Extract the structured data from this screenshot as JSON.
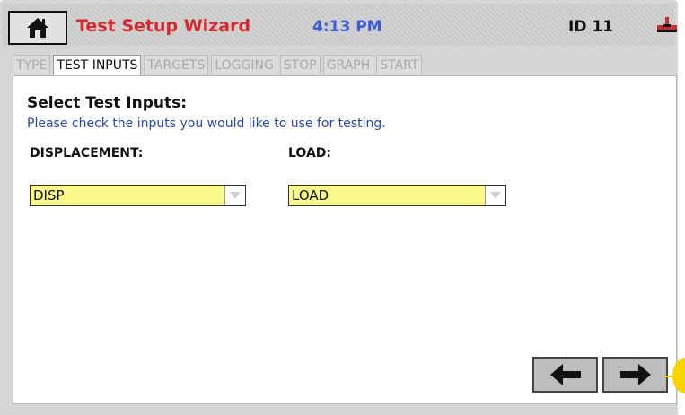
{
  "header": {
    "title": "Test Setup Wizard",
    "time": "4:13 PM",
    "id_label": "ID 11",
    "title_color": "#d6272c",
    "time_color": "#3b5ad8",
    "home_icon": "home-icon",
    "connection_icon": "pipe-connection-icon"
  },
  "tabs": [
    {
      "label": "TYPE",
      "active": false
    },
    {
      "label": "TEST INPUTS",
      "active": true
    },
    {
      "label": "TARGETS",
      "active": false
    },
    {
      "label": "LOGGING",
      "active": false
    },
    {
      "label": "STOP",
      "active": false
    },
    {
      "label": "GRAPH",
      "active": false
    },
    {
      "label": "START",
      "active": false
    }
  ],
  "main": {
    "heading": "Select Test Inputs:",
    "description": "Please check the inputs you would like to use for testing.",
    "displacement": {
      "label": "DISPLACEMENT:",
      "selected": "DISP"
    },
    "load": {
      "label": "LOAD:",
      "selected": "LOAD"
    },
    "select_color": "#fafa8c"
  },
  "navigation": {
    "back_icon": "arrow-left-icon",
    "next_icon": "arrow-right-icon"
  }
}
